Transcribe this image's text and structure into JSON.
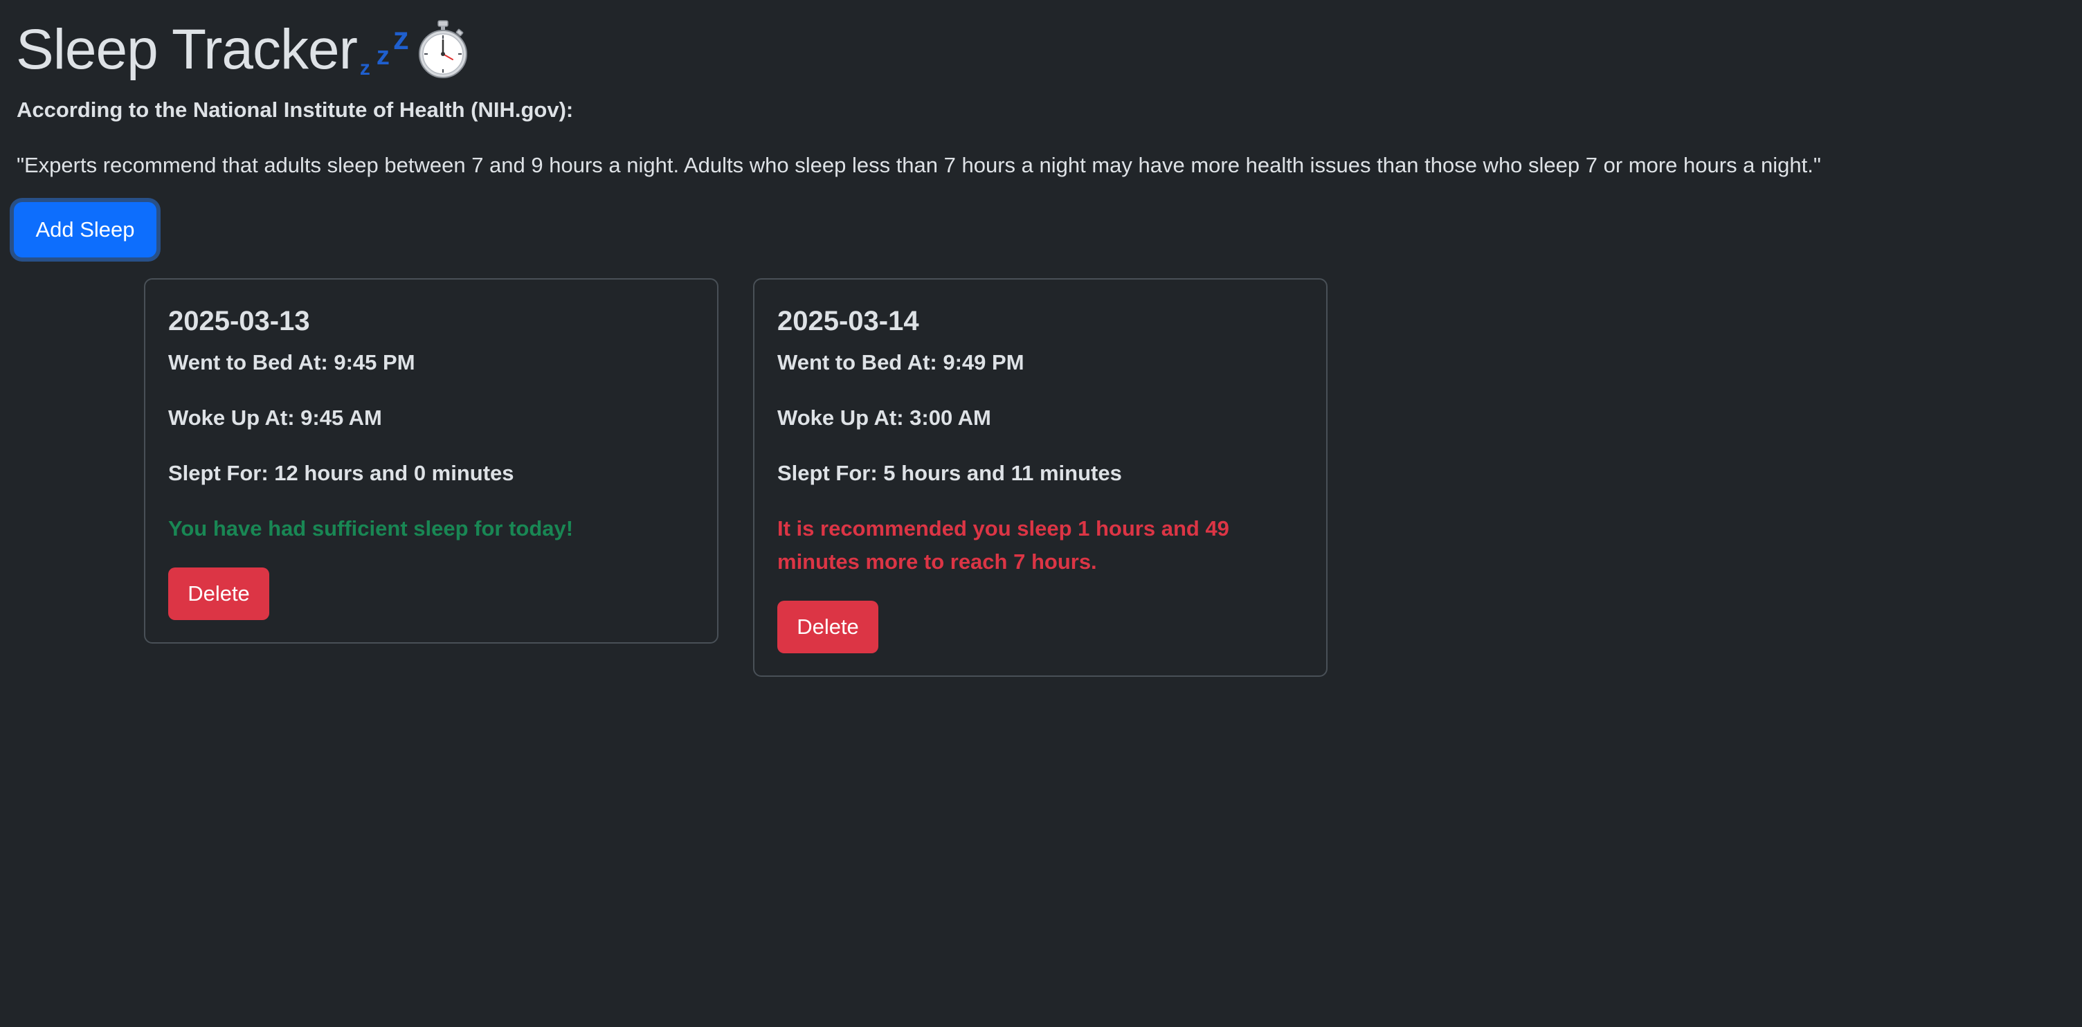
{
  "header": {
    "title": "Sleep Tracker",
    "title_icons": [
      "zzz-icon",
      "stopwatch-icon"
    ],
    "zzz_glyph": "z"
  },
  "intro": {
    "source": "According to the National Institute of Health (NIH.gov):",
    "quote": "\"Experts recommend that adults sleep between 7 and 9 hours a night. Adults who sleep less than 7 hours a night may have more health issues than those who sleep 7 or more hours a night.\""
  },
  "actions": {
    "add_label": "Add Sleep"
  },
  "colors": {
    "background": "#212529",
    "primary": "#0d6efd",
    "danger": "#dc3545",
    "success": "#198754",
    "text": "#dee2e6",
    "border": "#495057"
  },
  "entries": [
    {
      "date": "2025-03-13",
      "bed": "Went to Bed At: 9:45 PM",
      "woke": "Woke Up At: 9:45 AM",
      "slept": "Slept For: 12 hours and 0 minutes",
      "status": "You have had sufficient sleep for today!",
      "status_type": "success",
      "delete_label": "Delete"
    },
    {
      "date": "2025-03-14",
      "bed": "Went to Bed At: 9:49 PM",
      "woke": "Woke Up At: 3:00 AM",
      "slept": "Slept For: 5 hours and 11 minutes",
      "status": "It is recommended you sleep 1 hours and 49 minutes more to reach 7 hours.",
      "status_type": "danger",
      "delete_label": "Delete"
    }
  ]
}
